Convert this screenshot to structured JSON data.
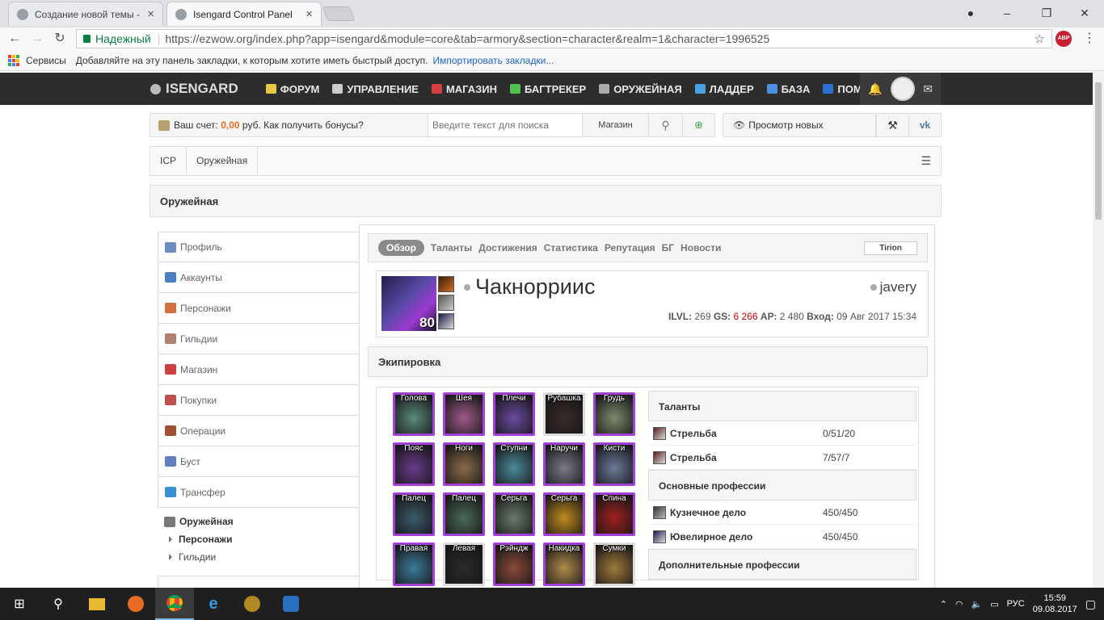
{
  "browser": {
    "tabs": [
      {
        "title": "Создание новой темы -",
        "active": false
      },
      {
        "title": "Isengard Control Panel",
        "active": true
      }
    ],
    "secure_label": "Надежный",
    "url": "https://ezwow.org/index.php?app=isengard&module=core&tab=armory&section=character&realm=1&character=1996525",
    "abp_label": "ABP",
    "bookmarks": {
      "apps_label": "Сервисы",
      "hint": "Добавляйте на эту панель закладки, к которым хотите иметь быстрый доступ.",
      "import_link": "Импортировать закладки..."
    }
  },
  "site": {
    "brand": "ISENGARD",
    "nav": [
      {
        "label": "ФОРУМ",
        "color": "#e8c840"
      },
      {
        "label": "УПРАВЛЕНИЕ",
        "color": "#cccccc"
      },
      {
        "label": "МАГАЗИН",
        "color": "#d44040"
      },
      {
        "label": "БАГТРЕКЕР",
        "color": "#50c050"
      },
      {
        "label": "ОРУЖЕЙНАЯ",
        "color": "#aaaaaa"
      },
      {
        "label": "ЛАДДЕР",
        "color": "#4aa0e0"
      },
      {
        "label": "БАЗА",
        "color": "#4a90e0"
      },
      {
        "label": "ПОМОЩЬ",
        "color": "#2a70d0"
      }
    ]
  },
  "toolbar": {
    "account_prefix": "Ваш счет:",
    "account_amount": "0,00",
    "account_suffix": "руб. Как получить бонусы?",
    "search_placeholder": "Введите текст для поиска",
    "shop_button": "Магазин",
    "view_new": "Просмотр новых"
  },
  "breadcrumb": [
    "ICP",
    "Оружейная"
  ],
  "page_title": "Оружейная",
  "sidebar": {
    "items": [
      {
        "label": "Профиль",
        "color": "#6a8ec0"
      },
      {
        "label": "Аккаунты",
        "color": "#4a80c0"
      },
      {
        "label": "Персонажи",
        "color": "#d07040"
      },
      {
        "label": "Гильдии",
        "color": "#b08070"
      },
      {
        "label": "Магазин",
        "color": "#d04040"
      },
      {
        "label": "Покупки",
        "color": "#c05050"
      },
      {
        "label": "Операции",
        "color": "#a05030"
      },
      {
        "label": "Буст",
        "color": "#6080c0"
      },
      {
        "label": "Трансфер",
        "color": "#3a90d0"
      }
    ],
    "active": {
      "label": "Оружейная",
      "subs": [
        "Персонажи",
        "Гильдии"
      ]
    }
  },
  "character_tabs": [
    "Обзор",
    "Таланты",
    "Достижения",
    "Статистика",
    "Репутация",
    "БГ",
    "Новости"
  ],
  "realm": "Tirion",
  "character": {
    "name": "Чакнорриис",
    "level": "80",
    "account": "javery",
    "ilvl_label": "ILVL:",
    "ilvl": "269",
    "gs_label": "GS:",
    "gs": "6 266",
    "ap_label": "АР:",
    "ap": "2 480",
    "login_label": "Вход:",
    "login": "09 Авг 2017 15:34"
  },
  "equipment": {
    "title": "Экипировка",
    "slots": [
      {
        "label": "Голова",
        "quality": "epic",
        "color": "#5a8a7a"
      },
      {
        "label": "Шея",
        "quality": "epic",
        "color": "#a05a8a"
      },
      {
        "label": "Плечи",
        "quality": "epic",
        "color": "#6a4aa0"
      },
      {
        "label": "Рубашка",
        "quality": "common",
        "color": "#3a2a2a"
      },
      {
        "label": "Грудь",
        "quality": "epic",
        "color": "#7a8a6a"
      },
      {
        "label": "Пояс",
        "quality": "epic",
        "color": "#6a3a8a"
      },
      {
        "label": "Ноги",
        "quality": "epic",
        "color": "#8a6a4a"
      },
      {
        "label": "Ступни",
        "quality": "epic",
        "color": "#4a8a9a"
      },
      {
        "label": "Наручи",
        "quality": "epic",
        "color": "#7a7a8a"
      },
      {
        "label": "Кисти",
        "quality": "epic",
        "color": "#6a7a9a"
      },
      {
        "label": "Палец",
        "quality": "epic",
        "color": "#3a5a6a"
      },
      {
        "label": "Палец",
        "quality": "epic",
        "color": "#4a6a5a"
      },
      {
        "label": "Серьга",
        "quality": "epic",
        "color": "#6a7a6a"
      },
      {
        "label": "Серьга",
        "quality": "epic",
        "color": "#c08a20"
      },
      {
        "label": "Спина",
        "quality": "epic",
        "color": "#a02020"
      },
      {
        "label": "Правая",
        "quality": "epic",
        "color": "#3a7a9a"
      },
      {
        "label": "Левая",
        "quality": "common",
        "color": "#2a2a2a"
      },
      {
        "label": "Рэйндж",
        "quality": "epic",
        "color": "#8a4a3a"
      },
      {
        "label": "Накидка",
        "quality": "epic",
        "color": "#b08a4a"
      },
      {
        "label": "Сумки",
        "quality": "common",
        "color": "#a07a3a"
      }
    ]
  },
  "talents": {
    "title": "Таланты",
    "rows": [
      {
        "name": "Стрельба",
        "value": "0/51/20"
      },
      {
        "name": "Стрельба",
        "value": "7/57/7"
      }
    ],
    "primary_title": "Основные профессии",
    "primary": [
      {
        "name": "Кузнечное дело",
        "value": "450/450"
      },
      {
        "name": "Ювелирное дело",
        "value": "450/450"
      }
    ],
    "secondary_title": "Дополнительные профессии"
  },
  "taskbar": {
    "lang": "РУС",
    "time": "15:59",
    "date": "09.08.2017"
  }
}
